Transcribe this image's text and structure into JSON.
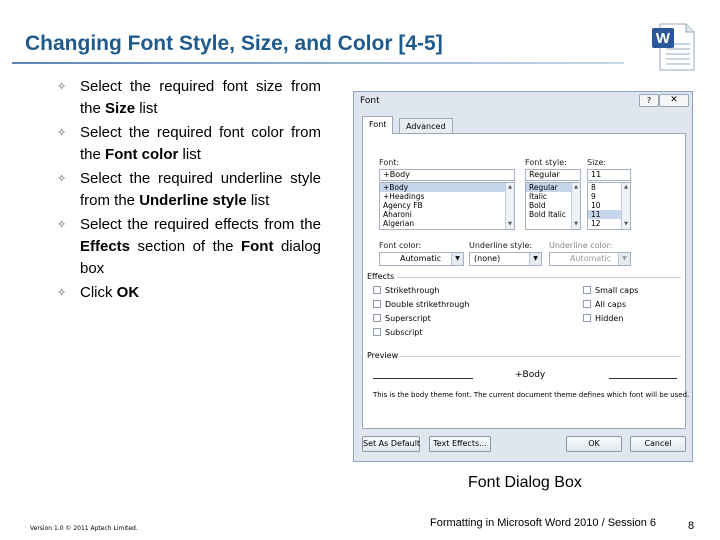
{
  "slide": {
    "title": "Changing Font Style, Size, and Color [4-5]",
    "bullets": [
      {
        "parts": [
          "Select the required font size from the ",
          "Size",
          " list"
        ]
      },
      {
        "parts": [
          "Select the required font color from the ",
          "Font color",
          " list"
        ]
      },
      {
        "parts": [
          "Select the required underline style from the ",
          "Underline style",
          " list"
        ]
      },
      {
        "parts": [
          "Select the required effects from the ",
          "Effects",
          " section of the ",
          "Font",
          " dialog box"
        ]
      },
      {
        "parts": [
          "Click ",
          "OK",
          ""
        ]
      }
    ],
    "caption": "Font Dialog Box",
    "footer_left": "Version 1.0 © 2011 Aptech Limited.",
    "footer_right": "Formatting in Microsoft Word 2010 / Session 6",
    "page_number": "8",
    "logo_letter": "W",
    "bullet_marker": "✧"
  },
  "dialog": {
    "title": "Font",
    "help_label": "?",
    "close_label": "✕",
    "tabs": [
      {
        "label": "Font",
        "active": true
      },
      {
        "label": "Advanced",
        "active": false
      }
    ],
    "font_label": "Font:",
    "font_value": "+Body",
    "font_list": [
      "+Body",
      "+Headings",
      "Agency FB",
      "Aharoni",
      "Algerian"
    ],
    "style_label": "Font style:",
    "style_value": "Regular",
    "style_list": [
      "Regular",
      "Italic",
      "Bold",
      "Bold Italic"
    ],
    "size_label": "Size:",
    "size_value": "11",
    "size_list": [
      "8",
      "9",
      "10",
      "11",
      "12"
    ],
    "font_color_label": "Font color:",
    "font_color_value": "Automatic",
    "underline_label": "Underline style:",
    "underline_value": "(none)",
    "underline_color_label": "Underline color:",
    "underline_color_value": "Automatic",
    "effects_label": "Effects",
    "effects_left": [
      "Strikethrough",
      "Double strikethrough",
      "Superscript",
      "Subscript"
    ],
    "effects_right": [
      "Small caps",
      "All caps",
      "Hidden"
    ],
    "preview_label": "Preview",
    "preview_sample": "+Body",
    "preview_note": "This is the body theme font. The current document theme defines which font will be used.",
    "buttons": {
      "set_default": "Set As Default",
      "text_effects": "Text Effects...",
      "ok": "OK",
      "cancel": "Cancel"
    }
  },
  "colors": {
    "title": "#1f5a8c",
    "word_blue": "#2b579a",
    "dialog_bg": "#dfe6ef"
  }
}
